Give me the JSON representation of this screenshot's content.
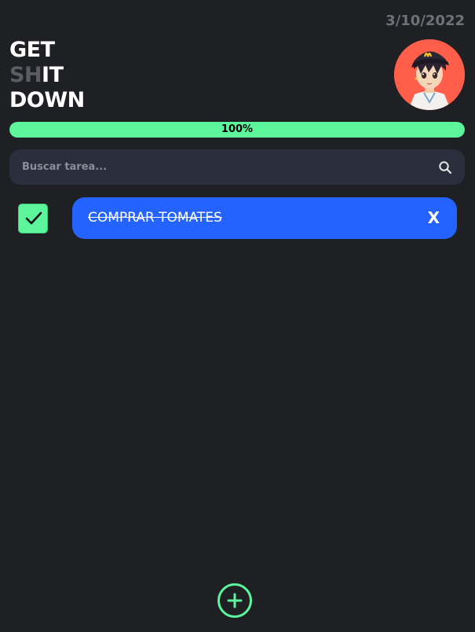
{
  "header": {
    "date": "3/10/2022",
    "title_line1": "GET",
    "title_line2_muted": "SH",
    "title_line2_rest": "IT",
    "title_line3": "DOWN"
  },
  "progress": {
    "percent": 100,
    "label": "100%"
  },
  "search": {
    "placeholder": "Buscar tarea...",
    "value": ""
  },
  "tasks": [
    {
      "text": "COMPRAR TOMATES",
      "completed": true,
      "delete_label": "X"
    }
  ],
  "colors": {
    "background": "#1f2024",
    "accent_green": "#5cf59b",
    "task_blue": "#2563ff",
    "avatar_bg": "#ff5e4a",
    "muted_text": "#6f7177"
  },
  "icons": {
    "search": "search-icon",
    "check": "check-icon",
    "add": "plus-icon"
  }
}
